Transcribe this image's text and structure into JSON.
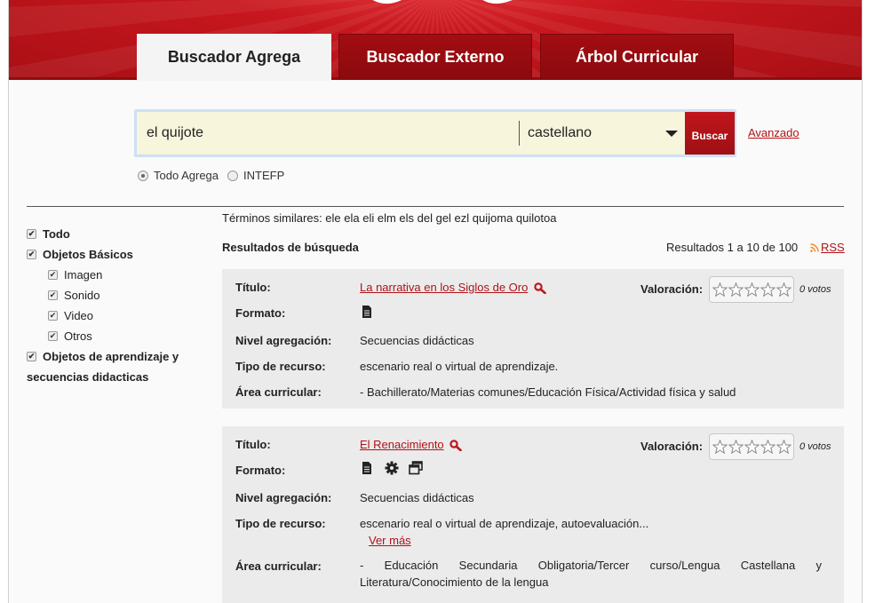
{
  "colors": {
    "brand_red": "#c8171e",
    "link_red": "#b01217",
    "search_bg": "#f7f5dc",
    "card_bg": "#ebebeb"
  },
  "tabs": [
    {
      "label": "Buscador Agrega",
      "active": true
    },
    {
      "label": "Buscador Externo",
      "active": false
    },
    {
      "label": "Árbol Curricular",
      "active": false
    }
  ],
  "search": {
    "query": "el quijote",
    "language": "castellano",
    "button_label": "Buscar",
    "advanced_label": "Avanzado",
    "scope_options": [
      {
        "label": "Todo Agrega",
        "selected": true
      },
      {
        "label": "INTEFP",
        "selected": false
      }
    ]
  },
  "filters": [
    {
      "label": "Todo",
      "checked": true,
      "level": 0
    },
    {
      "label": "Objetos Básicos",
      "checked": true,
      "level": 0
    },
    {
      "label": "Imagen",
      "checked": true,
      "level": 1
    },
    {
      "label": "Sonido",
      "checked": true,
      "level": 1
    },
    {
      "label": "Video",
      "checked": true,
      "level": 1
    },
    {
      "label": "Otros",
      "checked": true,
      "level": 1
    },
    {
      "label": "Objetos de aprendizaje y",
      "checked": true,
      "level": 0
    },
    {
      "label": "secuencias didacticas",
      "checked": null,
      "level": 0
    }
  ],
  "results": {
    "similar_terms": "Términos similares: ele ela eli elm els del gel ezl quijoma quilotoa",
    "title": "Resultados de búsqueda",
    "count_text": "Resultados 1 a 10 de 100",
    "rss_label": "RSS",
    "labels": {
      "titulo": "Título:",
      "formato": "Formato:",
      "nivel": "Nivel agregación:",
      "tipo": "Tipo de recurso:",
      "area": "Área curricular:",
      "valoracion": "Valoración:"
    },
    "items": [
      {
        "title": "La narrativa en los Siglos de Oro",
        "formats": [
          "document-icon"
        ],
        "nivel": "Secuencias didácticas",
        "tipo": "escenario real o virtual de aprendizaje.",
        "area": "- Bachillerato/Materias comunes/Educación Física/Actividad física y salud",
        "rating": 0,
        "votes": "0 votos"
      },
      {
        "title": "El Renacimiento",
        "formats": [
          "document-icon",
          "gear-icon",
          "windows-icon"
        ],
        "nivel": "Secuencias didácticas",
        "tipo": "escenario real o virtual de aprendizaje, autoevaluación...",
        "ver_mas": "Ver más",
        "area": "- Educación Secundaria Obligatoria/Tercer curso/Lengua Castellana y Literatura/Conocimiento de la lengua",
        "rating": 0,
        "votes": "0 votos"
      }
    ]
  }
}
